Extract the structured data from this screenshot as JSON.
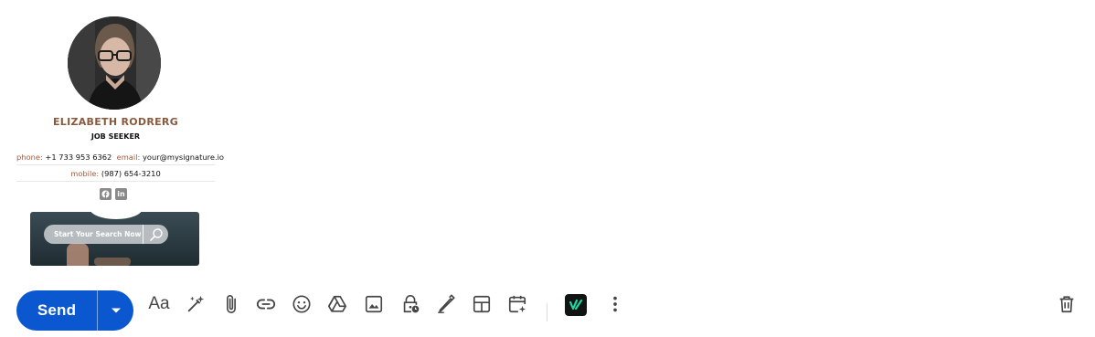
{
  "signature": {
    "name": "ELIZABETH RODRERG",
    "title": "JOB SEEKER",
    "phone_label": "phone:",
    "phone": "+1 733 953 6362",
    "email_label": "email:",
    "email": "your@mysignature.io",
    "mobile_label": "mobile:",
    "mobile": "(987) 654-3210",
    "socials": [
      "facebook-icon",
      "linkedin-icon"
    ],
    "linkedin_text": "in",
    "banner_search_text": "Start Your Search Now"
  },
  "toolbar": {
    "send_label": "Send",
    "formatting_label": "Aa",
    "icons": [
      "sparkle-pen-icon",
      "attach-icon",
      "link-icon",
      "emoji-icon",
      "drive-icon",
      "photo-icon",
      "confidential-lock-icon",
      "signature-pen-icon",
      "layouts-icon",
      "schedule-event-icon",
      "extension-icon",
      "more-options-icon",
      "trash-icon"
    ]
  },
  "colors": {
    "send_blue": "#0b57d0",
    "name_brown": "#8a5a3e",
    "icon_grey": "#444746",
    "extension_green": "#1fd5a0"
  }
}
